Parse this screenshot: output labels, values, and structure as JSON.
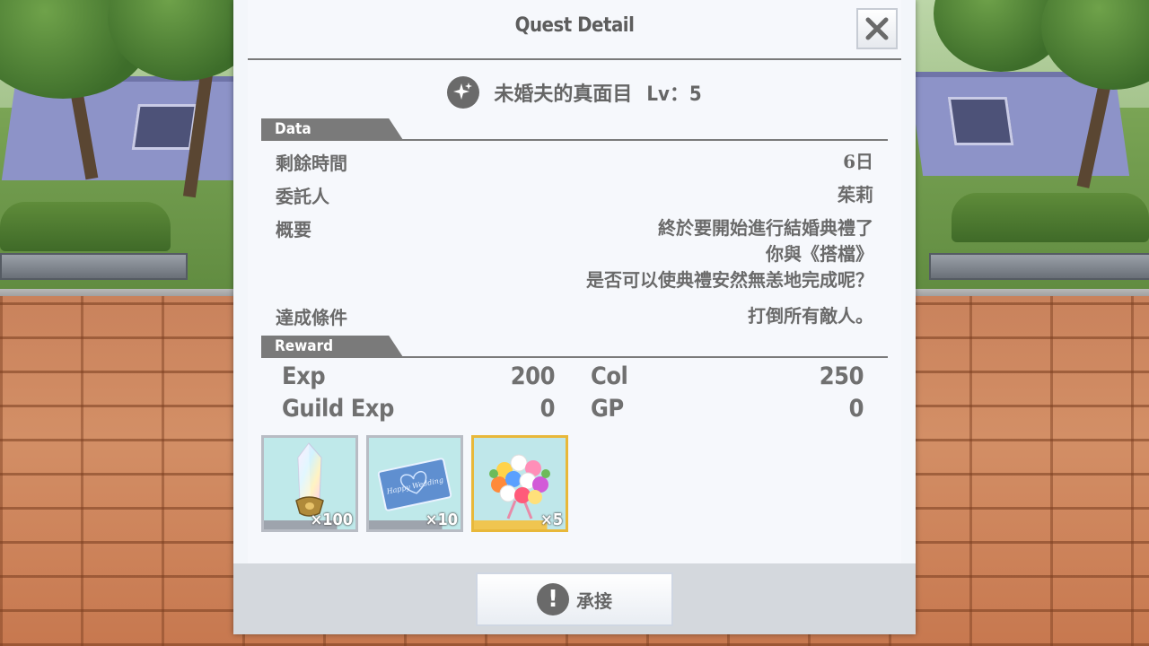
{
  "dialog": {
    "title": "Quest Detail",
    "close_icon": "close-icon"
  },
  "quest": {
    "icon": "sparkle-icon",
    "name": "未婚夫的真面目",
    "level": "Lv：5"
  },
  "data_section": {
    "heading": "Data",
    "remaining_time_label": "剩餘時間",
    "remaining_time_value": "6日",
    "client_label": "委託人",
    "client_value": "茱莉",
    "summary_label": "概要",
    "summary_lines": [
      "終於要開始進行結婚典禮了",
      "你與《搭檔》",
      "是否可以使典禮安然無恙地完成呢？"
    ],
    "condition_label": "達成條件",
    "condition_value": "打倒所有敵人。"
  },
  "reward_section": {
    "heading": "Reward",
    "exp_label": "Exp",
    "exp_value": "200",
    "guild_exp_label": "Guild Exp",
    "guild_exp_value": "0",
    "col_label": "Col",
    "col_value": "250",
    "gp_label": "GP",
    "gp_value": "0",
    "items": [
      {
        "name": "crystal-item",
        "count": "×100"
      },
      {
        "name": "wedding-card-item",
        "count": "×10"
      },
      {
        "name": "bouquet-item",
        "count": "×5"
      }
    ],
    "card_text": "Happy Wedding"
  },
  "footer": {
    "accept_label": "承接",
    "accept_icon": "exclamation-icon"
  }
}
